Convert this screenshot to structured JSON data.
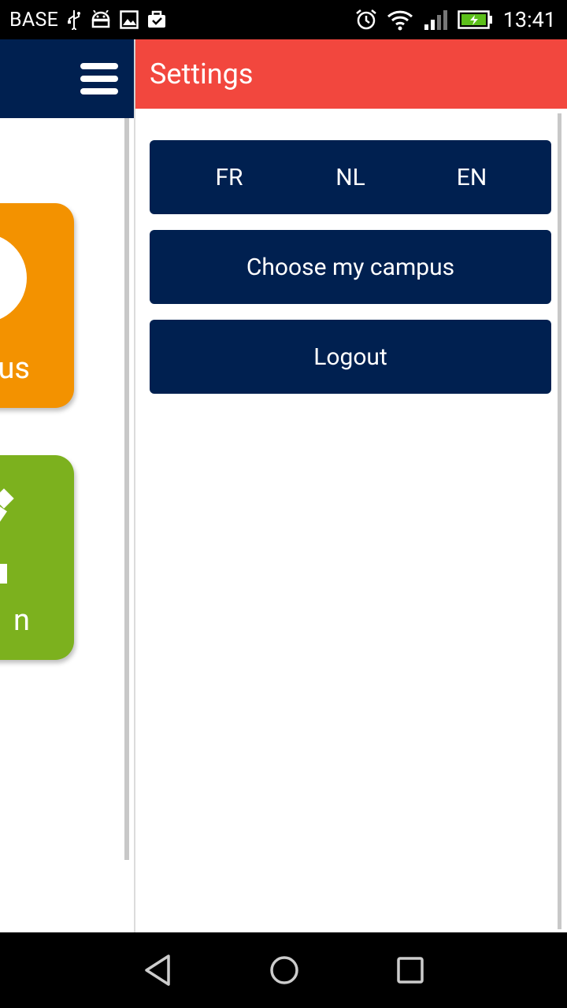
{
  "status_bar": {
    "carrier": "BASE",
    "time": "13:41",
    "icons": [
      "usb-icon",
      "android-debug-icon",
      "image-icon",
      "briefcase-icon",
      "alarm-icon",
      "wifi-icon",
      "signal-icon",
      "battery-charging-icon"
    ]
  },
  "left_panel": {
    "tiles": [
      {
        "label": "us",
        "color": "#f39200"
      },
      {
        "label": "n",
        "color": "#7cb11e"
      }
    ],
    "header_color": "#002050"
  },
  "settings": {
    "title": "Settings",
    "header_color": "#f2473e",
    "languages": [
      "FR",
      "NL",
      "EN"
    ],
    "choose_campus_label": "Choose my campus",
    "logout_label": "Logout",
    "button_color": "#002050"
  },
  "nav_bar": {
    "buttons": [
      "back-icon",
      "home-icon",
      "recent-apps-icon"
    ]
  }
}
